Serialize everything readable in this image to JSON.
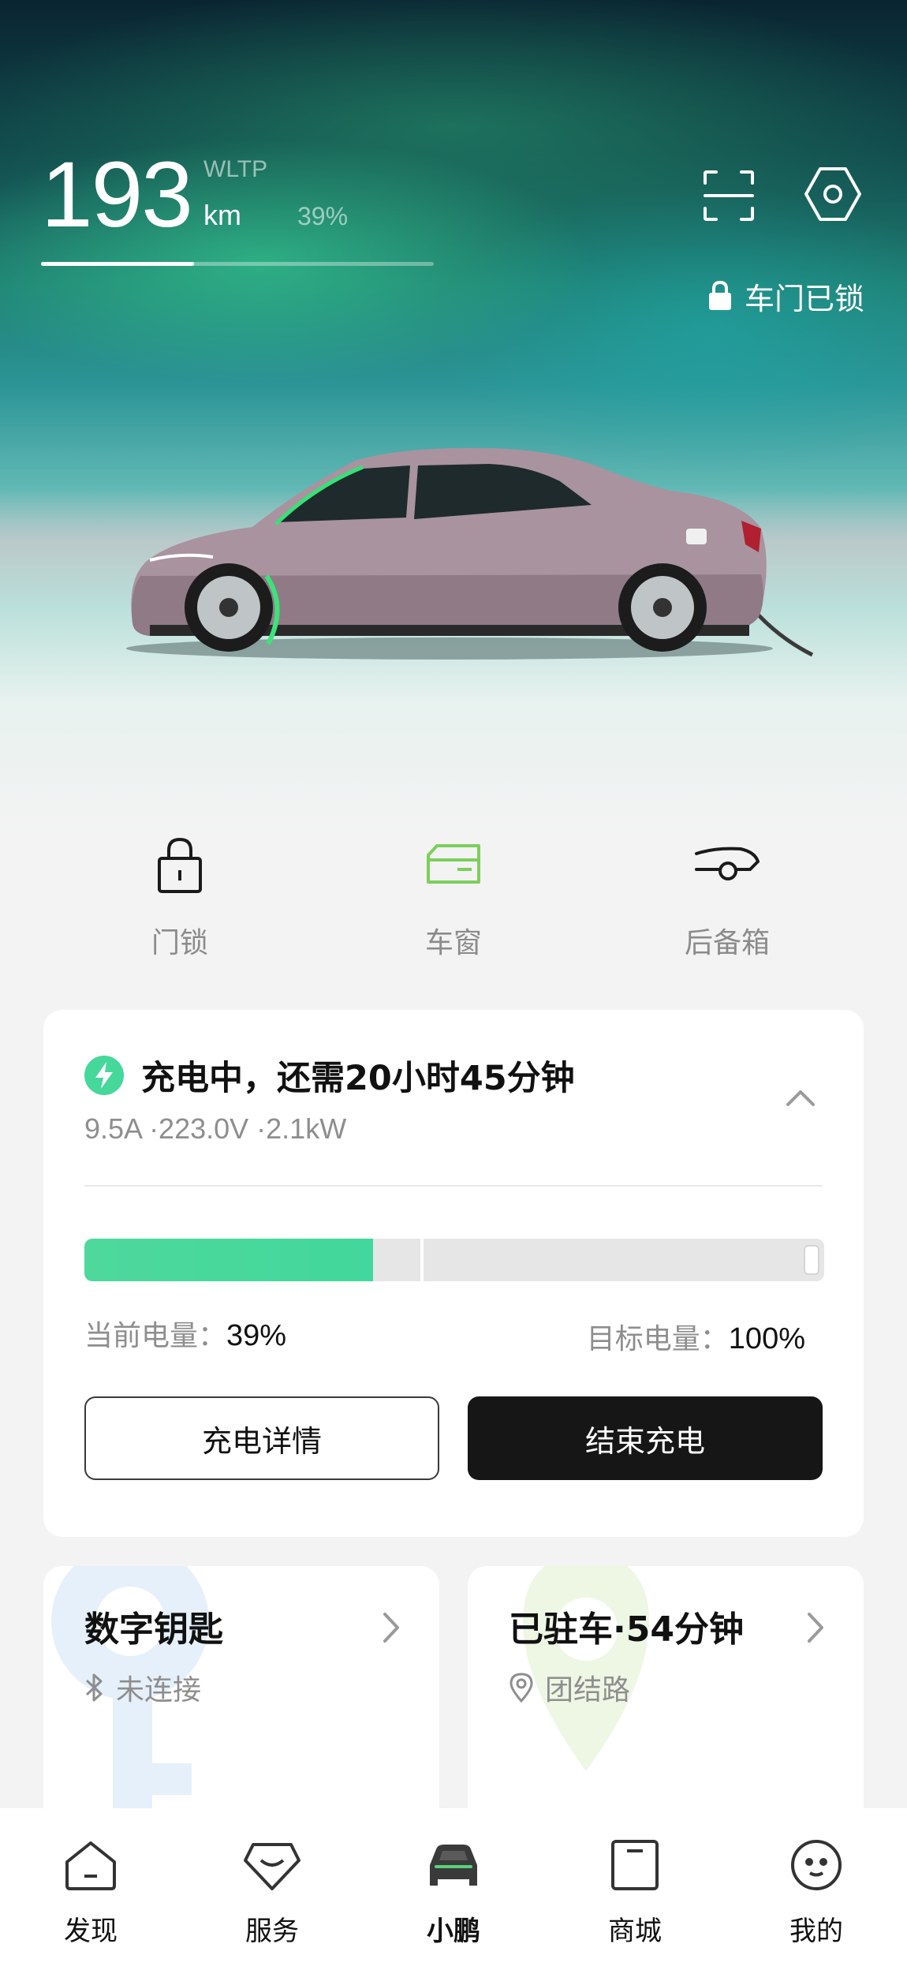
{
  "range": {
    "value": "193",
    "standard": "WLTP",
    "unit": "km",
    "battery_percent": "39%",
    "bar_fraction": 0.39
  },
  "header_icons": [
    "scan-icon",
    "settings-hexagon-icon"
  ],
  "lock_status": {
    "icon": "lock-icon",
    "text": "车门已锁"
  },
  "quick_controls": [
    {
      "icon": "door-lock-icon",
      "label": "门锁"
    },
    {
      "icon": "window-icon",
      "label": "车窗",
      "accent": "#7ccf5c"
    },
    {
      "icon": "trunk-icon",
      "label": "后备箱"
    }
  ],
  "charging": {
    "title": "充电中，还需20小时45分钟",
    "specs": "9.5A ·223.0V ·2.1kW",
    "current_level_label": "当前电量：",
    "current_level_value": "39%",
    "target_level_label": "目标电量：",
    "target_level_value": "100%",
    "current_fraction": 0.39,
    "target_fraction": 1.0,
    "details_button": "充电详情",
    "stop_button": "结束充电",
    "accent": "#45d89a"
  },
  "digital_key": {
    "title": "数字钥匙",
    "status": "未连接",
    "icon": "bluetooth-icon"
  },
  "parking": {
    "title": "已驻车·54分钟",
    "location": "团结路",
    "icon": "location-pin-icon"
  },
  "bottom_nav": [
    {
      "icon": "discover-icon",
      "label": "发现",
      "active": false
    },
    {
      "icon": "service-icon",
      "label": "服务",
      "active": false
    },
    {
      "icon": "car-icon",
      "label": "小鹏",
      "active": true
    },
    {
      "icon": "mall-icon",
      "label": "商城",
      "active": false
    },
    {
      "icon": "profile-icon",
      "label": "我的",
      "active": false
    }
  ]
}
